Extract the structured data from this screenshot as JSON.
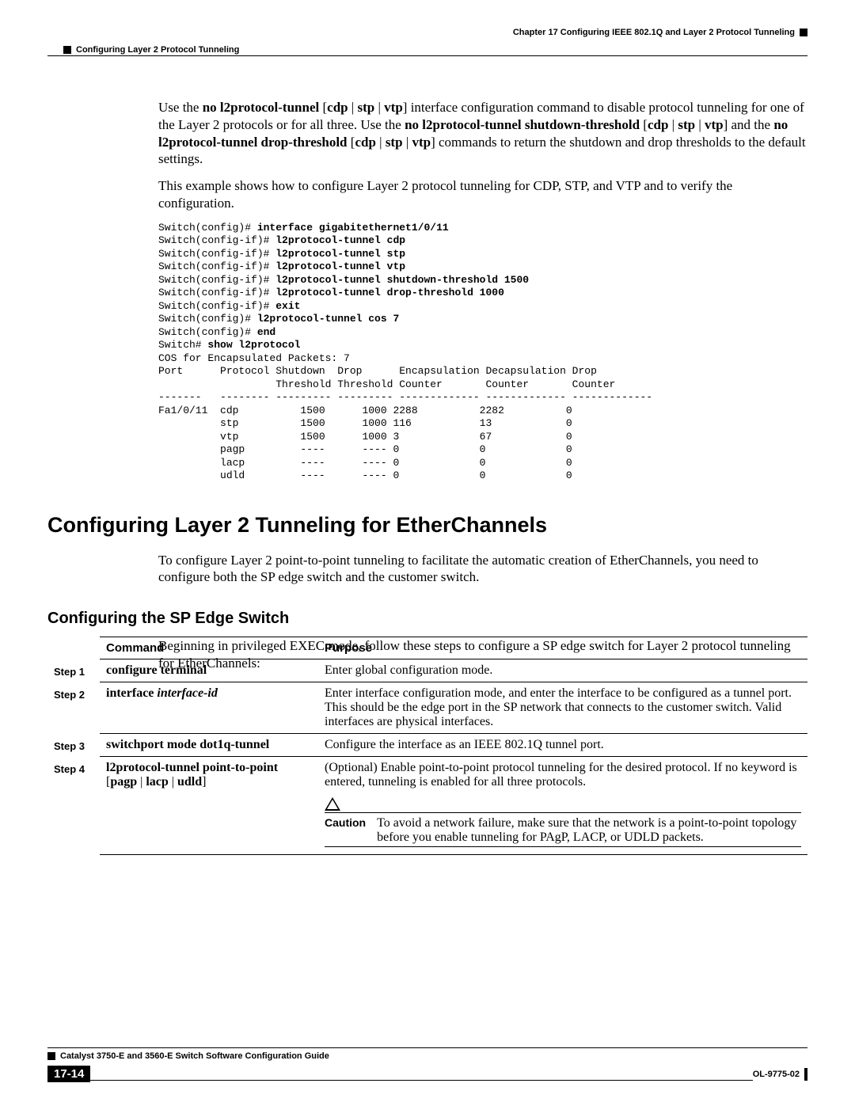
{
  "header": {
    "chapter": "Chapter 17    Configuring IEEE 802.1Q and Layer 2 Protocol Tunneling",
    "section": "Configuring Layer 2 Protocol Tunneling"
  },
  "para1_parts": [
    "Use the ",
    {
      "b": "no l2protocol-tunnel"
    },
    " [",
    {
      "b": "cdp"
    },
    " | ",
    {
      "b": "stp"
    },
    " | ",
    {
      "b": "vtp"
    },
    "] interface configuration command to disable protocol tunneling for one of the Layer 2 protocols or for all three. Use the ",
    {
      "b": "no l2protocol-tunnel shutdown-threshold"
    },
    " [",
    {
      "b": "cdp"
    },
    " | ",
    {
      "b": "stp"
    },
    " | ",
    {
      "b": "vtp"
    },
    "] and the ",
    {
      "b": "no l2protocol-tunnel drop-threshold"
    },
    " [",
    {
      "b": "cdp"
    },
    " | ",
    {
      "b": "stp"
    },
    " | ",
    {
      "b": "vtp"
    },
    "] commands to return the shutdown and drop thresholds to the default settings."
  ],
  "para2": "This example shows how to configure Layer 2 protocol tunneling for CDP, STP, and VTP and to verify the configuration.",
  "cli_lines": [
    {
      "p": "Switch(config)# ",
      "b": "interface gigabitethernet1/0/11"
    },
    {
      "p": "Switch(config-if)# ",
      "b": "l2protocol-tunnel cdp"
    },
    {
      "p": "Switch(config-if)# ",
      "b": "l2protocol-tunnel stp"
    },
    {
      "p": "Switch(config-if)# ",
      "b": "l2protocol-tunnel vtp"
    },
    {
      "p": "Switch(config-if)# ",
      "b": "l2protocol-tunnel shutdown-threshold 1500"
    },
    {
      "p": "Switch(config-if)# ",
      "b": "l2protocol-tunnel drop-threshold 1000"
    },
    {
      "p": "Switch(config-if)# ",
      "b": "exit"
    },
    {
      "p": "Switch(config)# ",
      "b": "l2protocol-tunnel cos 7"
    },
    {
      "p": "Switch(config)# ",
      "b": "end"
    },
    {
      "p": "Switch# ",
      "b": "show l2protocol"
    }
  ],
  "cli_output": "COS for Encapsulated Packets: 7\nPort      Protocol Shutdown  Drop      Encapsulation Decapsulation Drop\n                   Threshold Threshold Counter       Counter       Counter\n-------   -------- --------- --------- ------------- ------------- -------------\nFa1/0/11  cdp          1500      1000 2288          2282          0\n          stp          1500      1000 116           13            0\n          vtp          1500      1000 3             67            0\n          pagp         ----      ---- 0             0             0\n          lacp         ----      ---- 0             0             0\n          udld         ----      ---- 0             0             0",
  "h2": "Configuring Layer 2 Tunneling for EtherChannels",
  "para3": "To configure Layer 2 point-to-point tunneling to facilitate the automatic creation of EtherChannels, you need to configure both the SP edge switch and the customer switch.",
  "h3": "Configuring the SP Edge Switch",
  "para4": "Beginning in privileged EXEC mode, follow these steps to configure a SP edge switch for Layer 2 protocol tunneling for EtherChannels:",
  "table": {
    "head": {
      "c1": "",
      "c2": "Command",
      "c3": "Purpose"
    },
    "rows": [
      {
        "step": "Step 1",
        "cmd": [
          {
            "b": "configure terminal"
          }
        ],
        "purpose": "Enter global configuration mode."
      },
      {
        "step": "Step 2",
        "cmd": [
          {
            "b": "interface "
          },
          {
            "i": "interface-id"
          }
        ],
        "purpose": "Enter interface configuration mode, and enter the interface to be configured as a tunnel port. This should be the edge port in the SP network that connects to the customer switch. Valid interfaces are physical interfaces."
      },
      {
        "step": "Step 3",
        "cmd": [
          {
            "b": "switchport mode dot1q-tunnel"
          }
        ],
        "purpose": "Configure the interface as an IEEE 802.1Q tunnel port."
      },
      {
        "step": "Step 4",
        "cmd": [
          {
            "b": "l2protocol-tunnel point-to-point"
          },
          {
            "t": " ["
          },
          {
            "b": "pagp"
          },
          {
            "t": " | "
          },
          {
            "b": "lacp"
          },
          {
            "t": " | "
          },
          {
            "b": "udld"
          },
          {
            "t": "]"
          }
        ],
        "purpose": "(Optional) Enable point-to-point protocol tunneling for the desired protocol. If no keyword is entered, tunneling is enabled for all three protocols.",
        "caution": {
          "label": "Caution",
          "text": "To avoid a network failure, make sure that the network is a point-to-point topology before you enable tunneling for PAgP, LACP, or UDLD packets."
        }
      }
    ]
  },
  "footer": {
    "guide": "Catalyst 3750-E and 3560-E Switch Software Configuration Guide",
    "page": "17-14",
    "doc": "OL-9775-02"
  }
}
